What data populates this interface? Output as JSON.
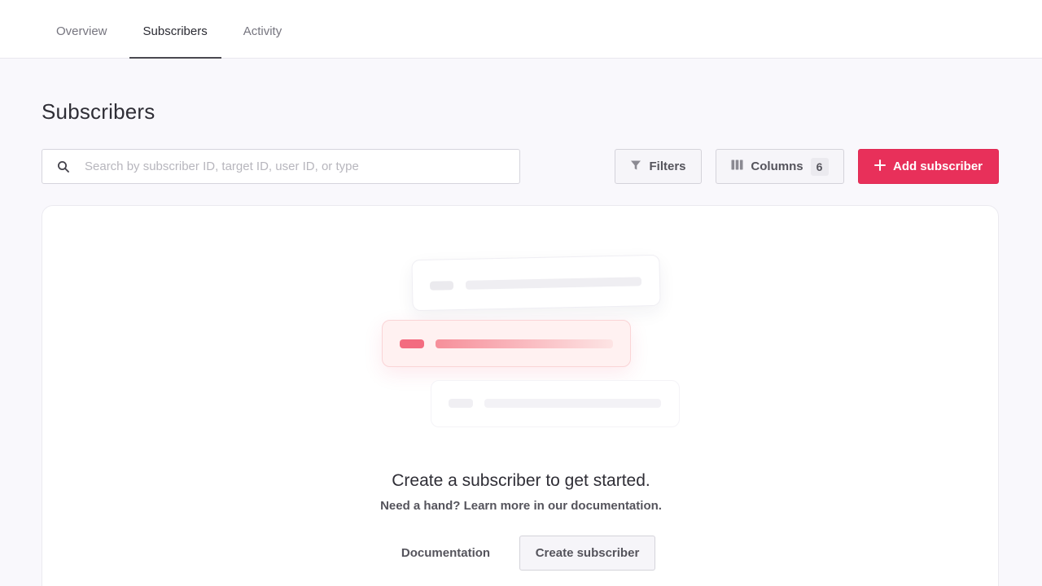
{
  "tabs": [
    {
      "label": "Overview",
      "active": false
    },
    {
      "label": "Subscribers",
      "active": true
    },
    {
      "label": "Activity",
      "active": false
    }
  ],
  "page": {
    "title": "Subscribers"
  },
  "search": {
    "placeholder": "Search by subscriber ID, target ID, user ID, or type",
    "value": "",
    "icon": "search-icon"
  },
  "toolbar": {
    "filters_label": "Filters",
    "filters_icon": "filter-icon",
    "columns_label": "Columns",
    "columns_icon": "columns-icon",
    "columns_count": "6",
    "add_label": "Add subscriber",
    "add_icon": "plus-icon"
  },
  "empty_state": {
    "title": "Create a subscriber to get started.",
    "subtitle": "Need a hand? Learn more in our documentation.",
    "doc_link": "Documentation",
    "create_button": "Create subscriber"
  },
  "colors": {
    "accent": "#e8305a",
    "background": "#f9f8fc",
    "text": "#2b2b33",
    "muted": "#76757f"
  }
}
